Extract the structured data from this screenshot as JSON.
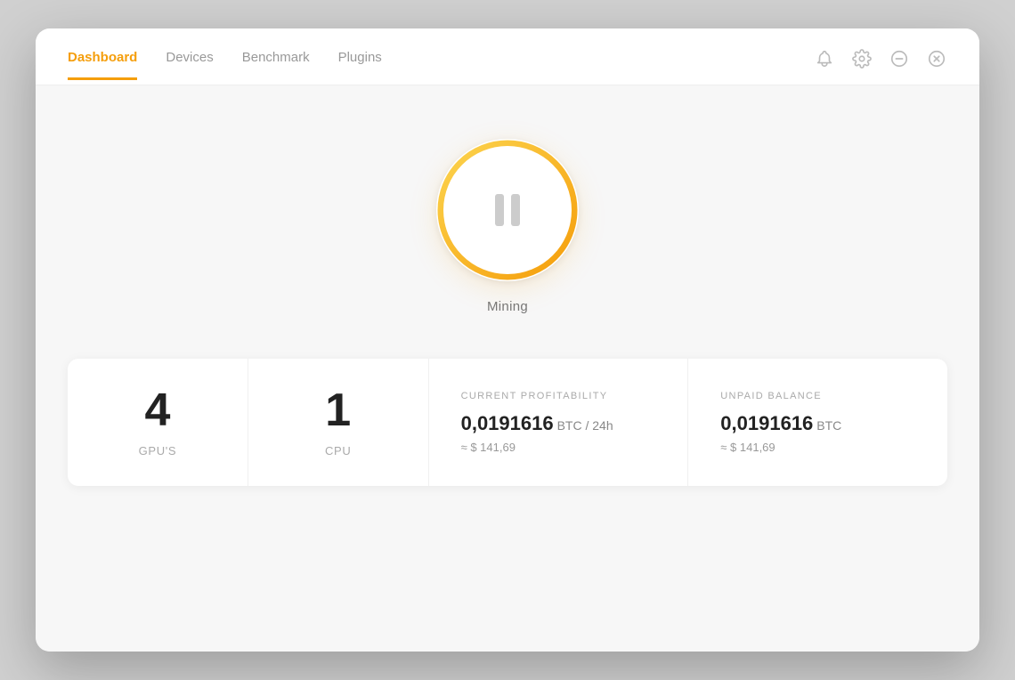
{
  "nav": {
    "items": [
      {
        "id": "dashboard",
        "label": "Dashboard",
        "active": true
      },
      {
        "id": "devices",
        "label": "Devices",
        "active": false
      },
      {
        "id": "benchmark",
        "label": "Benchmark",
        "active": false
      },
      {
        "id": "plugins",
        "label": "Plugins",
        "active": false
      }
    ],
    "icons": [
      {
        "id": "bell",
        "name": "bell-icon"
      },
      {
        "id": "settings",
        "name": "settings-icon"
      },
      {
        "id": "minimize",
        "name": "minimize-icon"
      },
      {
        "id": "close",
        "name": "close-icon"
      }
    ]
  },
  "mining": {
    "status_label": "Mining",
    "button_state": "paused"
  },
  "stats": {
    "gpus": {
      "value": "4",
      "label": "GPU'S"
    },
    "cpu": {
      "value": "1",
      "label": "CPU"
    },
    "current_profitability": {
      "section_label": "CURRENT PROFITABILITY",
      "btc_value": "0,0191616",
      "btc_unit": "BTC / 24h",
      "usd_approx": "≈ $ 141,69"
    },
    "unpaid_balance": {
      "section_label": "UNPAID BALANCE",
      "btc_value": "0,0191616",
      "btc_unit": "BTC",
      "usd_approx": "≈ $ 141,69"
    }
  },
  "colors": {
    "accent": "#f59e0b",
    "accent_light": "#fcd34d",
    "text_dark": "#222",
    "text_muted": "#999",
    "text_label": "#aaa"
  }
}
